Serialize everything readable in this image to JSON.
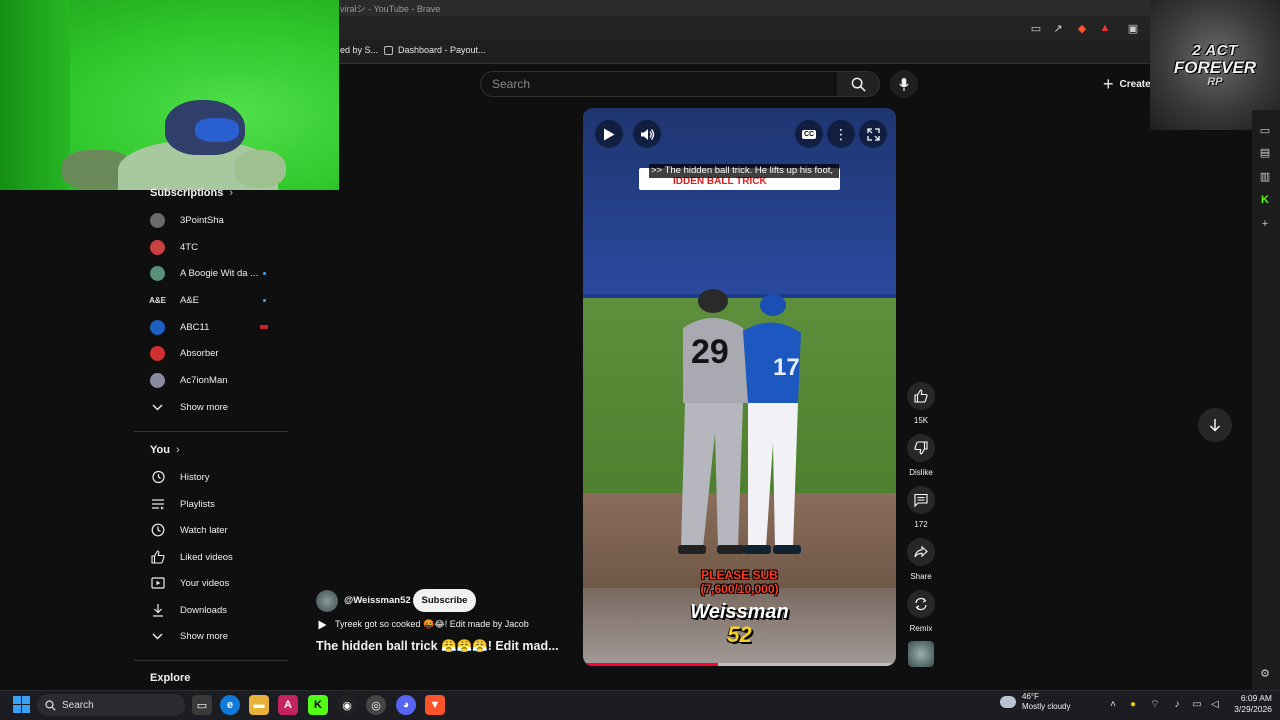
{
  "browser": {
    "window_title": "viralシ - YouTube - Brave",
    "bookmarks": [
      {
        "label": "ed by S..."
      },
      {
        "label": "Dashboard - Payout..."
      }
    ]
  },
  "header": {
    "search_placeholder": "Search",
    "create_label": "Create"
  },
  "logo_overlay": {
    "line1": "2 ACT",
    "line2": "FOREVER",
    "line3": "RP"
  },
  "sidebar": {
    "subscriptions_title": "Subscriptions",
    "subscriptions": [
      {
        "label": "3PointSha",
        "avatar_color": "#6a6a6a",
        "live": false
      },
      {
        "label": "4TC",
        "avatar_color": "#c84040",
        "live": false
      },
      {
        "label": "A Boogie Wit da ...",
        "avatar_color": "#5a8f7a",
        "live": true
      },
      {
        "label": "A&E",
        "avatar_color": "#dddddd",
        "live": true
      },
      {
        "label": "ABC11",
        "avatar_color": "#1e5fbf",
        "live": true,
        "live_color": "#cc2222"
      },
      {
        "label": "Absorber",
        "avatar_color": "#d03030",
        "live": false
      },
      {
        "label": "Ac7ionMan",
        "avatar_color": "#8a8aa0",
        "live": false
      }
    ],
    "show_more_label": "Show more",
    "you_title": "You",
    "you_items": [
      {
        "label": "History",
        "icon": "history-icon"
      },
      {
        "label": "Playlists",
        "icon": "playlists-icon"
      },
      {
        "label": "Watch later",
        "icon": "watch-later-icon"
      },
      {
        "label": "Liked videos",
        "icon": "liked-videos-icon"
      },
      {
        "label": "Your videos",
        "icon": "your-videos-icon"
      },
      {
        "label": "Downloads",
        "icon": "downloads-icon"
      }
    ],
    "you_show_more_label": "Show more",
    "explore_title": "Explore"
  },
  "video": {
    "caption": ">> The hidden ball trick. He lifts up his foot,",
    "title_overlay": "IDDEN BALL TRICK",
    "overlay_line1": "PLEASE SUB",
    "overlay_line2": "(7,600/10,000)",
    "overlay_brand1": "Weissman",
    "overlay_brand2": "52",
    "jersey_number_left": "29",
    "jersey_number_right": "17",
    "progress_fraction": 0.43,
    "accent_color": "#ff0033"
  },
  "actions": {
    "like_count": "15K",
    "dislike_label": "Dislike",
    "comments_count": "172",
    "share_label": "Share",
    "remix_label": "Remix"
  },
  "channel": {
    "handle": "@Weissman52",
    "subscribe_label": "Subscribe",
    "description": "Tyreek got so cooked 🤬😂! Edit made by Jacob",
    "video_title": "The hidden ball trick 😤😤😤! Edit mad..."
  },
  "taskbar": {
    "search_label": "Search",
    "weather_temp": "46°F",
    "weather_desc": "Mostly cloudy",
    "time": "6:09 AM",
    "date": "3/29/2026"
  }
}
